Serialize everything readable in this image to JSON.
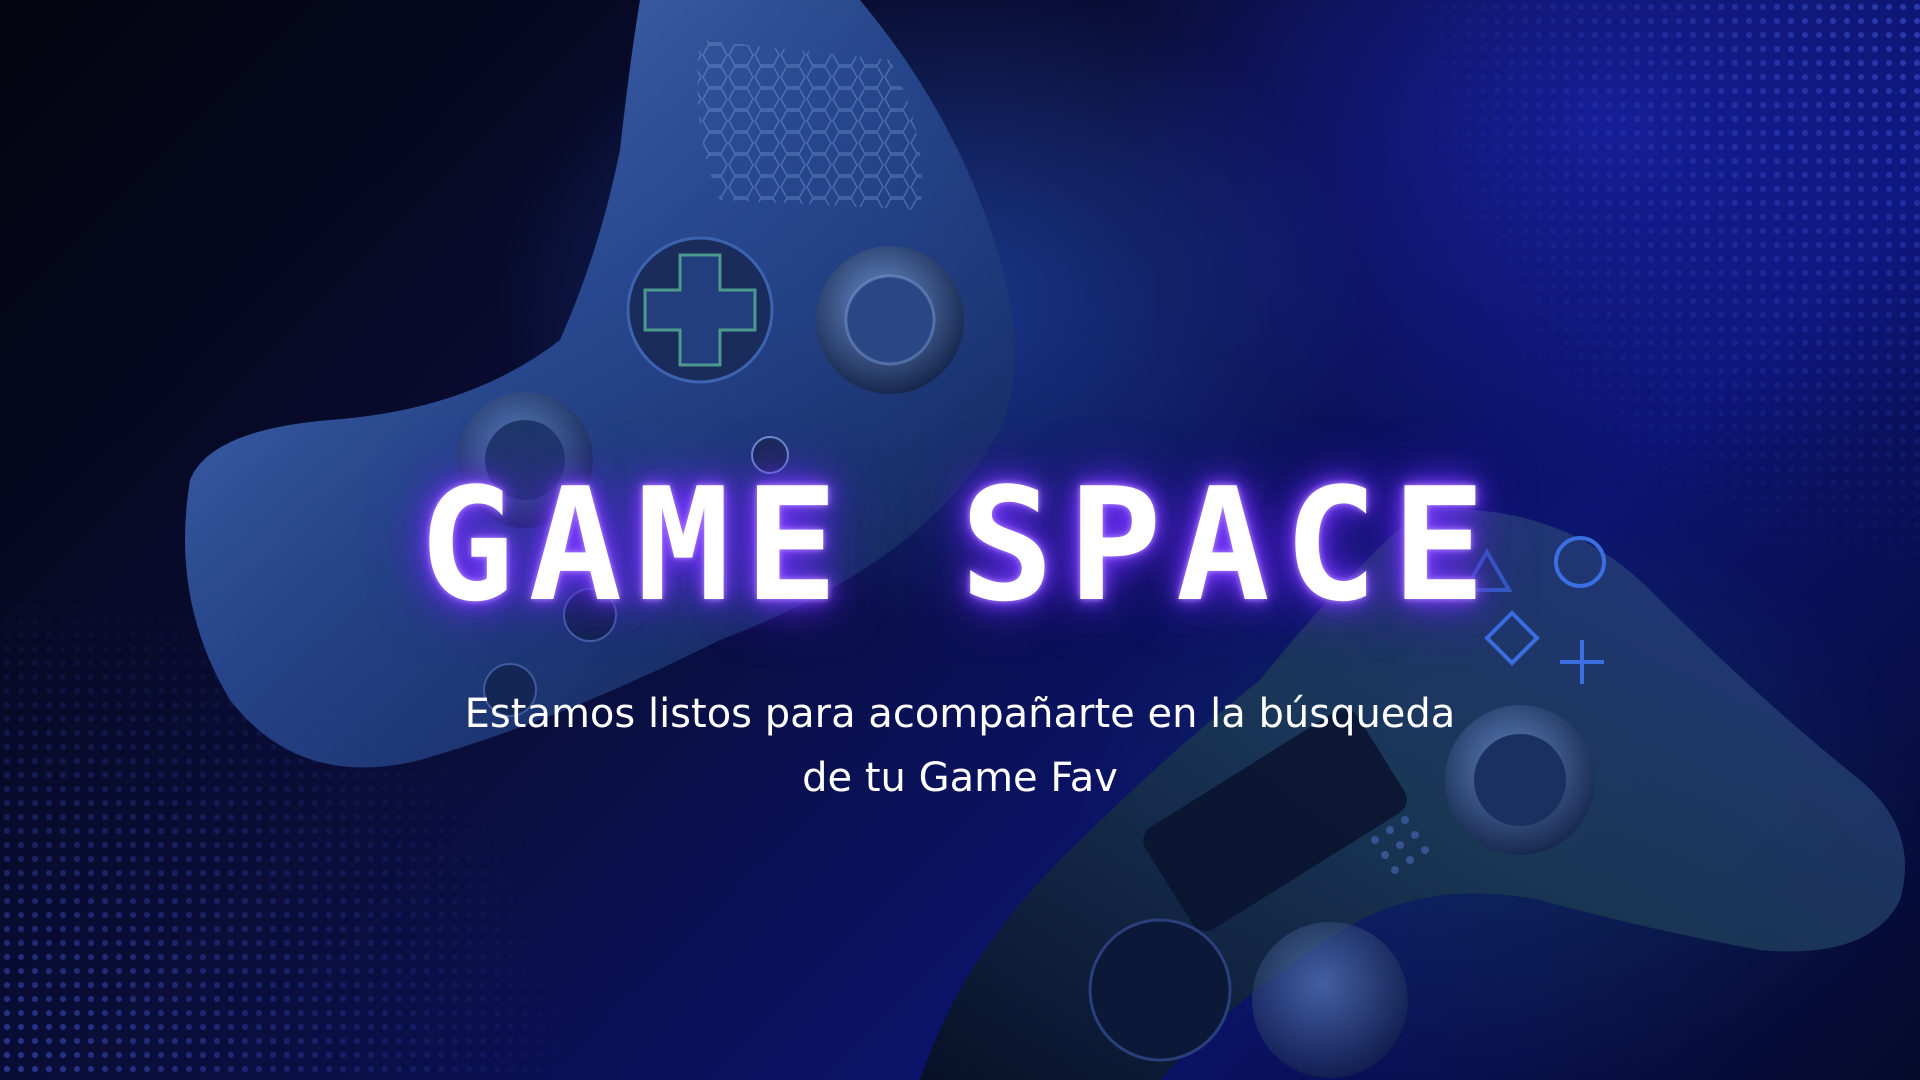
{
  "hero": {
    "title": "GAME SPACE",
    "subtitle_line1": "Estamos listos para acompañarte en la búsqueda",
    "subtitle_line2": "de tu Game Fav"
  },
  "icons": [
    "xbox-controller-icon",
    "playstation-controller-icon"
  ],
  "colors": {
    "background_dark": "#04061a",
    "background_blue": "#0b1470",
    "title_text": "#ffffff",
    "title_glow": "#8a4dff",
    "subtitle_text": "#ffffff",
    "dot_pattern": "#4658dc"
  }
}
